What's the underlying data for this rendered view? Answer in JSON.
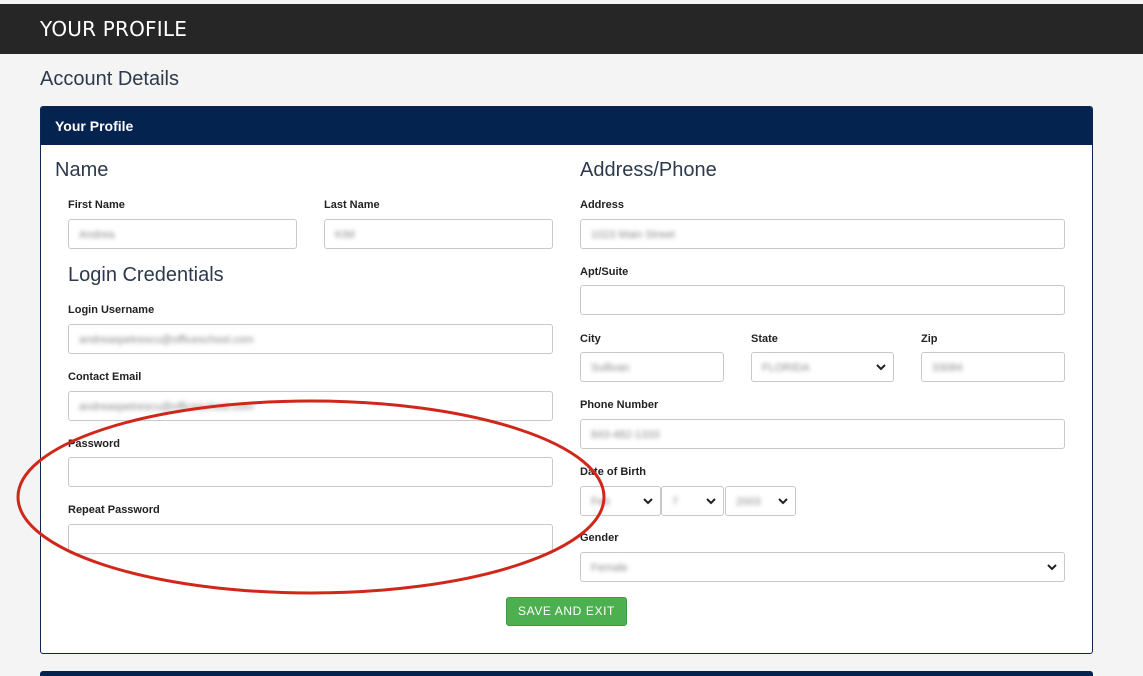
{
  "topbar": {
    "title": "YOUR PROFILE"
  },
  "page": {
    "heading": "Account Details"
  },
  "card": {
    "header": "Your Profile"
  },
  "name_section": {
    "title": "Name",
    "first_name_label": "First Name",
    "first_name_value": "Andrea",
    "last_name_label": "Last Name",
    "last_name_value": "KIM"
  },
  "login_section": {
    "title": "Login Credentials",
    "username_label": "Login Username",
    "username_value": "andreaspetrescu@officeschool.com",
    "email_label": "Contact Email",
    "email_value": "andreaspetrescu@officeschool.com",
    "password_label": "Password",
    "password_value": "",
    "repeat_password_label": "Repeat Password",
    "repeat_password_value": ""
  },
  "address_section": {
    "title": "Address/Phone",
    "address_label": "Address",
    "address_value": "1023 Main Street",
    "apt_label": "Apt/Suite",
    "apt_value": "",
    "city_label": "City",
    "city_value": "Sullivan",
    "state_label": "State",
    "state_value": "FLORIDA",
    "zip_label": "Zip",
    "zip_value": "33084",
    "phone_label": "Phone Number",
    "phone_value": "843-482-1333",
    "dob_label": "Date of Birth",
    "dob_month": "Feb",
    "dob_day": "7",
    "dob_year": "2003",
    "gender_label": "Gender",
    "gender_value": "Female"
  },
  "actions": {
    "save_label": "SAVE AND EXIT"
  },
  "colors": {
    "header": "#05234f",
    "topbar": "#262626",
    "save": "#4caf50",
    "annotation": "#d0271a"
  }
}
